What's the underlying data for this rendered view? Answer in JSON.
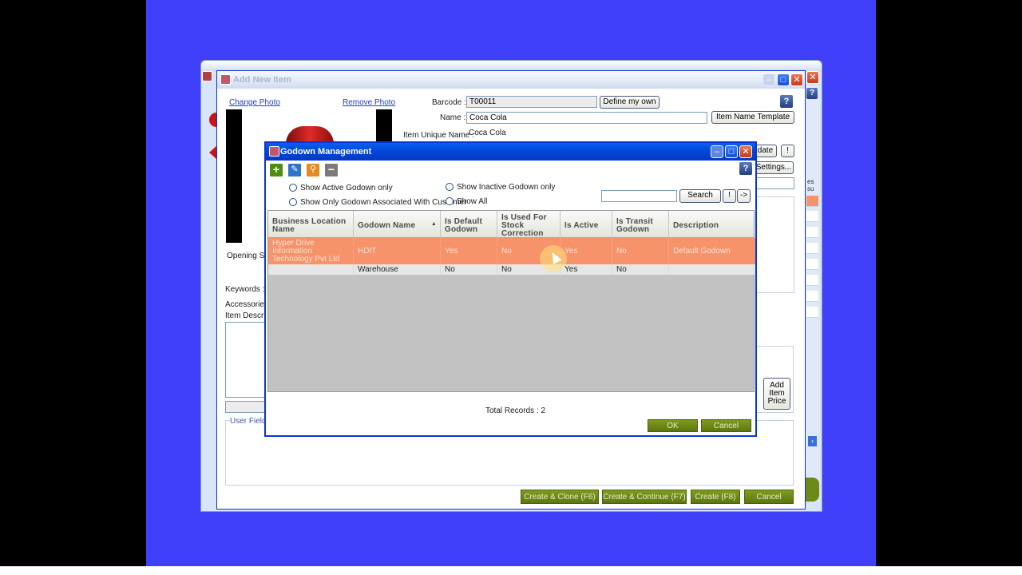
{
  "item_window": {
    "title": "Add New Item",
    "change_photo": "Change Photo",
    "remove_photo": "Remove Photo",
    "barcode_label": "Barcode :",
    "barcode_value": "T00011",
    "define_my_own": "Define my own",
    "name_label": "Name :",
    "name_value": "Coca Cola",
    "item_name_template": "Item Name Template",
    "unique_name_label": "Item Unique Name :",
    "unique_name_value": "Coca Cola",
    "partial_update_btn": "date",
    "partial_info_btn": "!",
    "partial_settings_btn": "Settings...",
    "opening_stock_label": "Opening Sto",
    "keywords_label": "Keywords :",
    "accessories_label": "Accessories I",
    "item_description_label": "Item Descript",
    "user_field_label": "User Field U",
    "add_item_price": "Add Item Price",
    "create_clone": "Create & Clone  (F6)",
    "create_continue": "Create & Continue (F7)",
    "create": "Create (F8)",
    "cancel": "Cancel",
    "help": "?",
    "side_partial_a": "es",
    "side_partial_b": "su"
  },
  "godown_dialog": {
    "title": "Godown Management",
    "help": "?",
    "filters": {
      "show_active": "Show Active Godown only",
      "show_inactive": "Show Inactive Godown only",
      "show_customer": "Show Only Godown Associated With Customer",
      "show_all": "Show All"
    },
    "search_value": "",
    "search_button": "Search",
    "info_button": "!",
    "next_button": "->",
    "columns": [
      "Business Location Name",
      "Godown Name",
      "Is Default Godown",
      "Is Used For Stock Correction",
      "Is Active",
      "Is Transit Godown",
      "Description"
    ],
    "rows": [
      {
        "business_location": "Hyper Drive Information Technology Pvt Ltd",
        "godown_name": "HDIT",
        "is_default": "Yes",
        "stock_correction": "No",
        "is_active": "Yes",
        "is_transit": "No",
        "description": "Default Godown"
      },
      {
        "business_location": "",
        "godown_name": "Warehouse",
        "is_default": "No",
        "stock_correction": "No",
        "is_active": "Yes",
        "is_transit": "No",
        "description": ""
      }
    ],
    "total_records": "Total Records : 2",
    "ok": "OK",
    "cancel": "Cancel"
  },
  "colors": {
    "desktop": "#4040fb",
    "selected_row": "#f6936a",
    "green_button": "#6c8a18",
    "titlebar_blue": "#0247d8"
  }
}
